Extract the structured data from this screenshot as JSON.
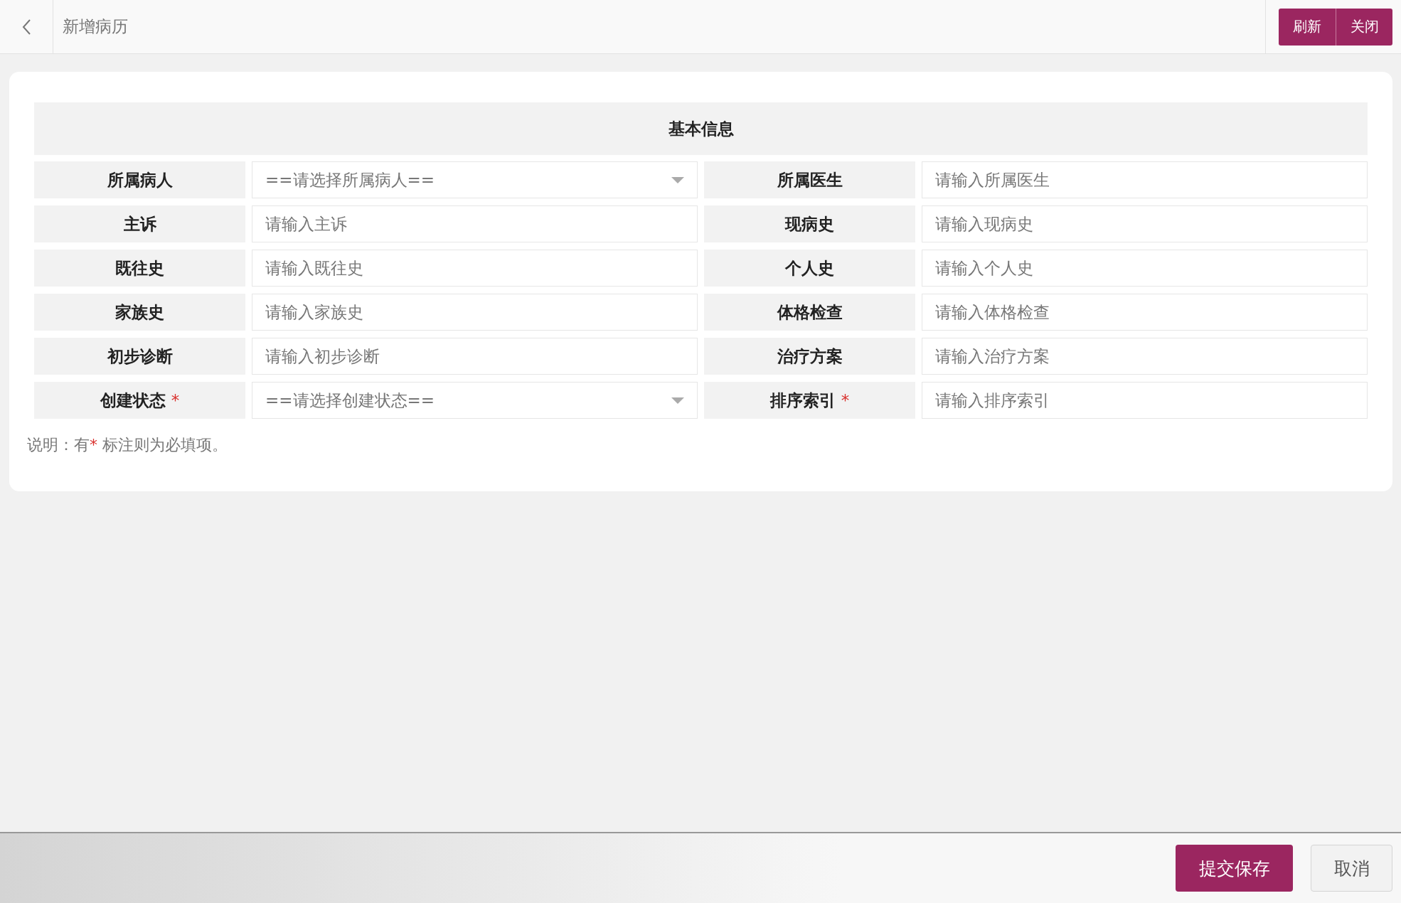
{
  "header": {
    "title": "新增病历",
    "buttons": [
      "刷新",
      "关闭"
    ]
  },
  "section": {
    "title": "基本信息"
  },
  "fields": [
    {
      "label": "所属病人",
      "kind": "select",
      "placeholder": "==请选择所属病人==",
      "required": false
    },
    {
      "label": "所属医生",
      "kind": "text",
      "placeholder": "请输入所属医生",
      "required": false
    },
    {
      "label": "主诉",
      "kind": "text",
      "placeholder": "请输入主诉",
      "required": false
    },
    {
      "label": "现病史",
      "kind": "text",
      "placeholder": "请输入现病史",
      "required": false
    },
    {
      "label": "既往史",
      "kind": "text",
      "placeholder": "请输入既往史",
      "required": false
    },
    {
      "label": "个人史",
      "kind": "text",
      "placeholder": "请输入个人史",
      "required": false
    },
    {
      "label": "家族史",
      "kind": "text",
      "placeholder": "请输入家族史",
      "required": false
    },
    {
      "label": "体格检查",
      "kind": "text",
      "placeholder": "请输入体格检查",
      "required": false
    },
    {
      "label": "初步诊断",
      "kind": "text",
      "placeholder": "请输入初步诊断",
      "required": false
    },
    {
      "label": "治疗方案",
      "kind": "text",
      "placeholder": "请输入治疗方案",
      "required": false
    },
    {
      "label": "创建状态",
      "kind": "select",
      "placeholder": "==请选择创建状态==",
      "required": true
    },
    {
      "label": "排序索引",
      "kind": "text",
      "placeholder": "请输入排序索引",
      "required": true
    }
  ],
  "required_mark": "*",
  "note": {
    "before": "说明：有",
    "mark": "*",
    "after": " 标注则为必填项。"
  },
  "footer": {
    "submit": "提交保存",
    "cancel": "取消"
  }
}
